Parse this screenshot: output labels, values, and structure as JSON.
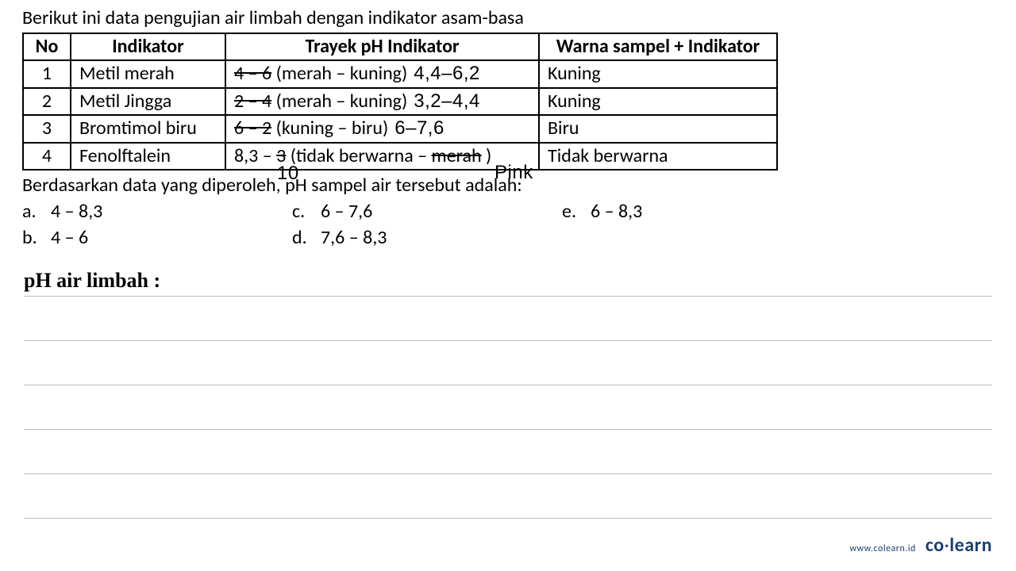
{
  "intro": "Berikut ini data pengujian air limbah dengan indikator asam-basa",
  "headers": {
    "no": "No",
    "ind": "Indikator",
    "trayek": "Trayek pH Indikator",
    "warna": "Warna sampel + Indikator"
  },
  "rows": [
    {
      "no": "1",
      "ind": "Metil merah",
      "strike": "4 – 6",
      "desc": " (merah – kuning)",
      "hand": "4,4–6,2",
      "warna": "Kuning"
    },
    {
      "no": "2",
      "ind": "Metil Jingga",
      "strike": "2 – 4",
      "desc": " (merah – kuning)",
      "hand": "3,2–4,4",
      "warna": "Kuning"
    },
    {
      "no": "3",
      "ind": "Bromtimol biru",
      "strike": "6 – 2",
      "desc": " (kuning – biru)",
      "hand": "6–7,6",
      "warna": "Biru"
    },
    {
      "no": "4",
      "ind": "Fenolftalein",
      "pre": "8,3 – ",
      "strike1": "3",
      "mid": " (tidak berwarna – ",
      "strike2": "merah",
      "post": " )",
      "warna": "Tidak berwarna"
    }
  ],
  "annot10": "10",
  "annotPink": "Pink",
  "question": "Berdasarkan data yang diperoleh, pH sampel air tersebut adalah:",
  "options": {
    "a": "4 – 8,3",
    "b": "4 – 6",
    "c": "6 – 7,6",
    "d": "7,6 – 8,3",
    "e": "6 – 8,3"
  },
  "letters": {
    "a": "a.",
    "b": "b.",
    "c": "c.",
    "d": "d.",
    "e": "e."
  },
  "phTitle": "pH air limbah :",
  "footer": {
    "url": "www.colearn.id",
    "logo_pre": "co",
    "logo_dot": "·",
    "logo_post": "learn"
  }
}
